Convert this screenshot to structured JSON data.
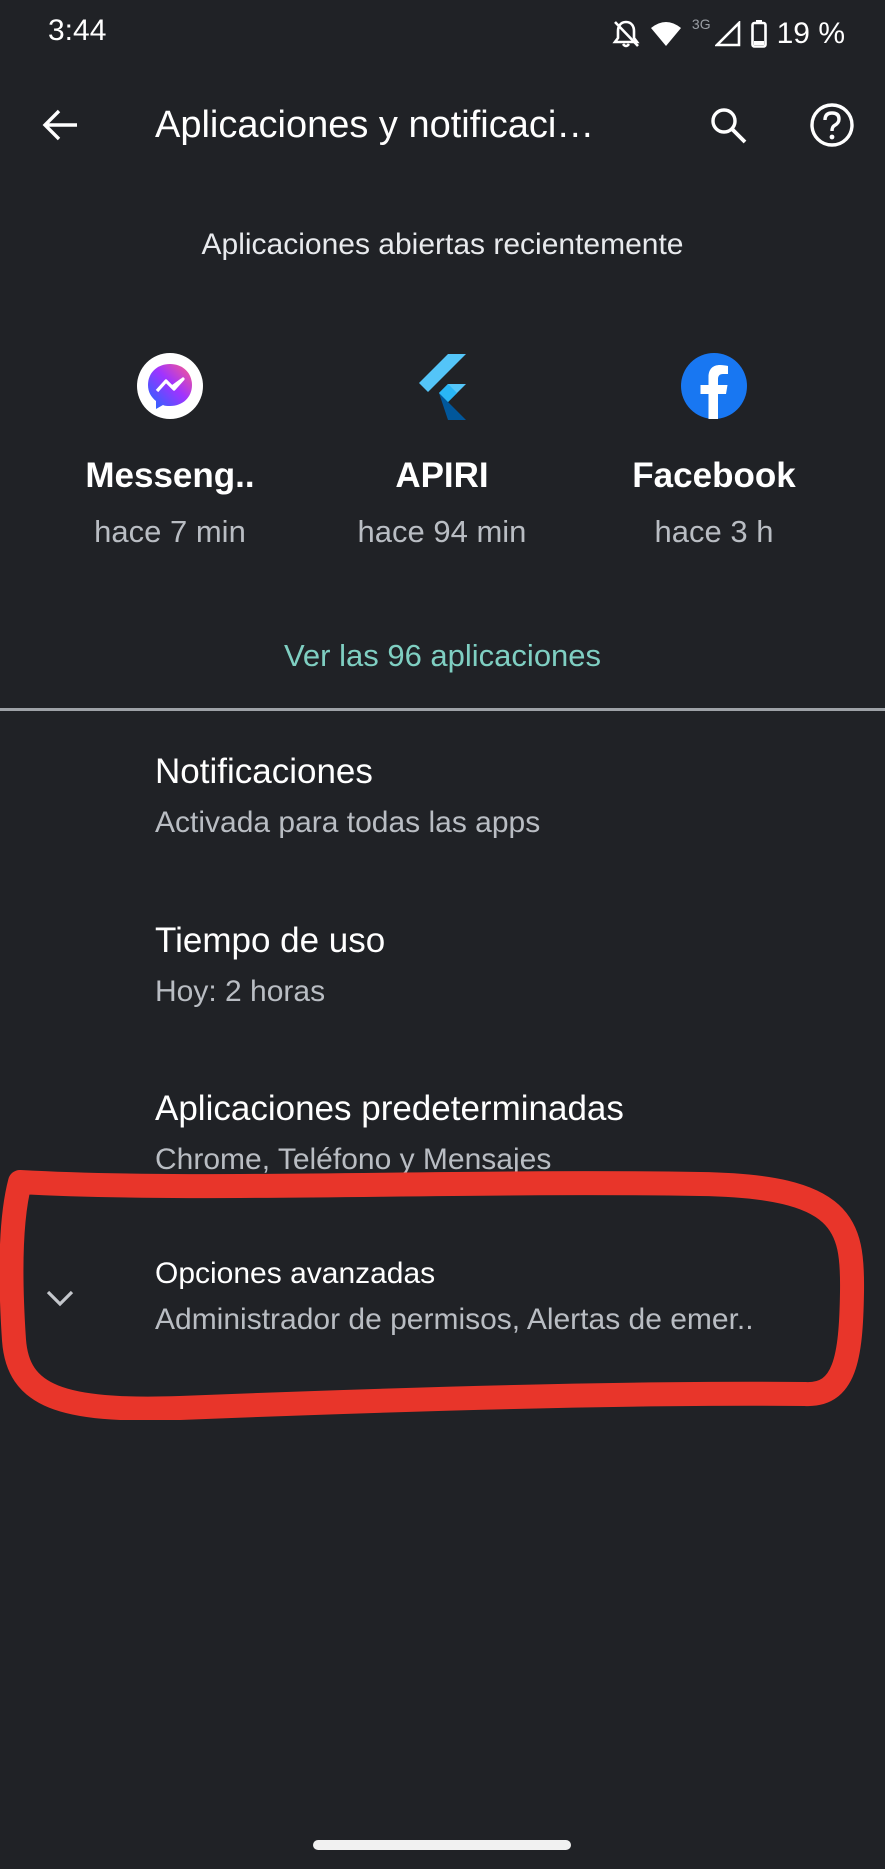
{
  "status_bar": {
    "time": "3:44",
    "network_label": "3G",
    "battery": "19 %",
    "icons": [
      "alarm-off-icon",
      "wifi-icon",
      "signal-icon",
      "battery-icon"
    ]
  },
  "app_bar": {
    "title": "Aplicaciones y notificaci…",
    "icons": [
      "back-arrow-icon",
      "search-icon",
      "help-icon"
    ]
  },
  "recent_apps": {
    "section_title": "Aplicaciones abiertas recientemente",
    "apps": [
      {
        "name": "Messeng..",
        "time": "hace 7 min",
        "icon": "messenger-icon"
      },
      {
        "name": "APIRI",
        "time": "hace 94 min",
        "icon": "flutter-icon"
      },
      {
        "name": "Facebook",
        "time": "hace 3 h",
        "icon": "facebook-icon"
      }
    ],
    "see_all": "Ver las 96 aplicaciones"
  },
  "settings_list": [
    {
      "title": "Notificaciones",
      "subtitle": "Activada para todas las apps"
    },
    {
      "title": "Tiempo de uso",
      "subtitle": "Hoy: 2 horas"
    },
    {
      "title": "Aplicaciones predeterminadas",
      "subtitle": "Chrome, Teléfono y Mensajes"
    },
    {
      "title": "Opciones avanzadas",
      "subtitle": "Administrador de permisos, Alertas de emer..",
      "icon": "chevron-down-icon"
    }
  ],
  "colors": {
    "background": "#202226",
    "accent": "#7fcfc2",
    "annotation": "#e8352a"
  }
}
